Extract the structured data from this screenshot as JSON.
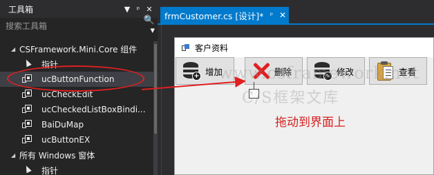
{
  "toolbox": {
    "title": "工具箱",
    "header_buttons": [
      "▼",
      "ᵖ",
      "✕"
    ],
    "search_placeholder": "搜索工具箱",
    "search_icon": "🔍 ▾",
    "groups": [
      {
        "label": "CSFramework.Mini.Core 组件",
        "items": [
          {
            "label": "指针",
            "icon": "pointer-icon"
          },
          {
            "label": "ucButtonFunction",
            "icon": "component-icon",
            "selected": true
          },
          {
            "label": "ucCheckEdit",
            "icon": "component-icon"
          },
          {
            "label": "ucCheckedListBoxBindi...",
            "icon": "component-icon"
          },
          {
            "label": "BaiDuMap",
            "icon": "component-icon"
          },
          {
            "label": "ucButtonEX",
            "icon": "component-icon"
          }
        ]
      },
      {
        "label": "所有 Windows 窗体",
        "items": [
          {
            "label": "指针",
            "icon": "pointer-icon"
          }
        ]
      }
    ]
  },
  "document": {
    "tab_title": "frmCustomer.cs [设计]*",
    "pin_icon": "ᵖ",
    "close_icon": "✕"
  },
  "form": {
    "title": "客户资料",
    "buttons": [
      {
        "label": "增加",
        "icon": "database-add-icon"
      },
      {
        "label": "删除",
        "icon": "delete-x-icon"
      },
      {
        "label": "修改",
        "icon": "database-edit-icon"
      },
      {
        "label": "查看",
        "icon": "clipboard-view-icon"
      }
    ]
  },
  "watermark": {
    "line1": "www.csframework.net",
    "line2": "C/S框架文库"
  },
  "annotation": {
    "hint_text": "拖动到界面上",
    "color": "#e02020"
  },
  "colors": {
    "accent": "#007acc",
    "panel_bg": "#252526",
    "ide_bg": "#2d2d30",
    "annotation_red": "#e02020"
  }
}
